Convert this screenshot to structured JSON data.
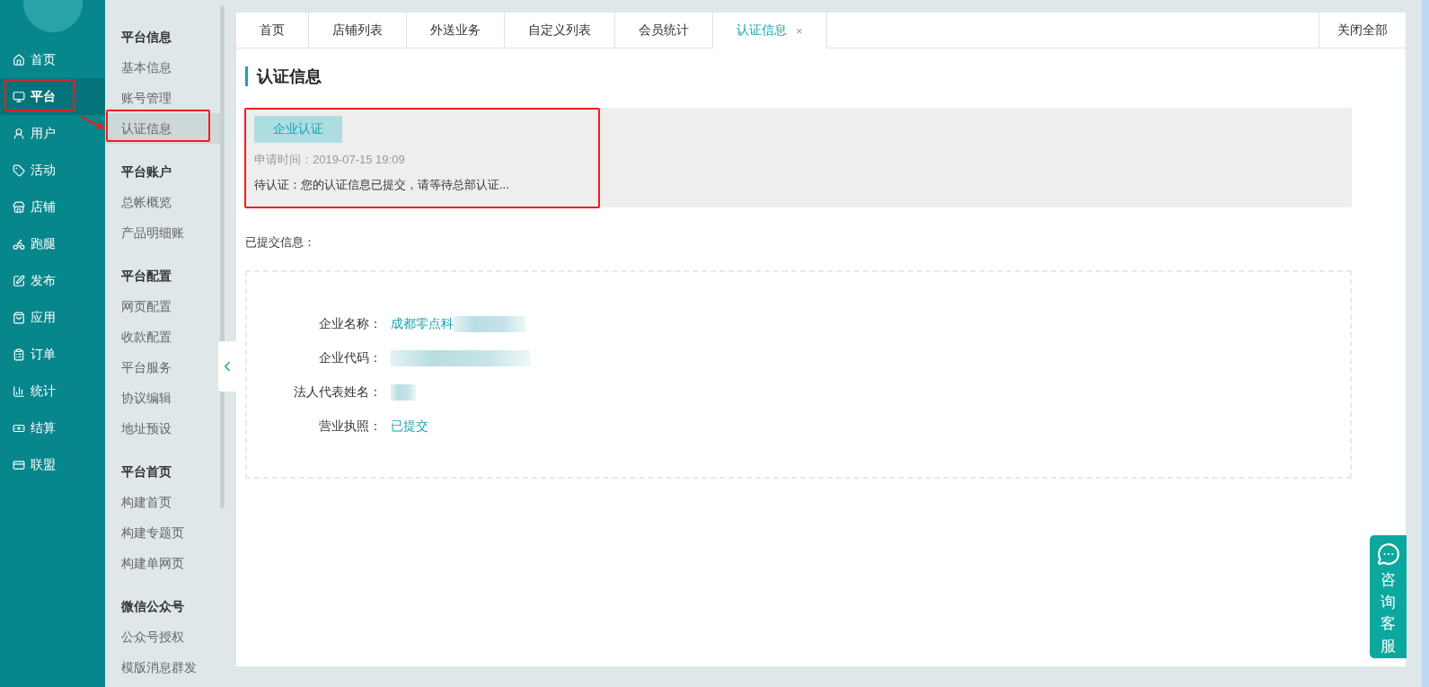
{
  "nav_rail": {
    "items": [
      {
        "label": "首页",
        "selected": false
      },
      {
        "label": "平台",
        "selected": true
      },
      {
        "label": "用户",
        "selected": false
      },
      {
        "label": "活动",
        "selected": false
      },
      {
        "label": "店铺",
        "selected": false
      },
      {
        "label": "跑腿",
        "selected": false
      },
      {
        "label": "发布",
        "selected": false
      },
      {
        "label": "应用",
        "selected": false
      },
      {
        "label": "订单",
        "selected": false
      },
      {
        "label": "统计",
        "selected": false
      },
      {
        "label": "结算",
        "selected": false
      },
      {
        "label": "联盟",
        "selected": false
      }
    ]
  },
  "sub_nav": {
    "groups": [
      {
        "title": "平台信息",
        "items": [
          {
            "label": "基本信息",
            "selected": false
          },
          {
            "label": "账号管理",
            "selected": false
          },
          {
            "label": "认证信息",
            "selected": true
          }
        ]
      },
      {
        "title": "平台账户",
        "items": [
          {
            "label": "总帐概览",
            "selected": false
          },
          {
            "label": "产品明细账",
            "selected": false
          }
        ]
      },
      {
        "title": "平台配置",
        "items": [
          {
            "label": "网页配置",
            "selected": false
          },
          {
            "label": "收款配置",
            "selected": false
          },
          {
            "label": "平台服务",
            "selected": false
          },
          {
            "label": "协议编辑",
            "selected": false
          },
          {
            "label": "地址预设",
            "selected": false
          }
        ]
      },
      {
        "title": "平台首页",
        "items": [
          {
            "label": "构建首页",
            "selected": false
          },
          {
            "label": "构建专题页",
            "selected": false
          },
          {
            "label": "构建单网页",
            "selected": false
          }
        ]
      },
      {
        "title": "微信公众号",
        "items": [
          {
            "label": "公众号授权",
            "selected": false
          },
          {
            "label": "模版消息群发",
            "selected": false
          }
        ]
      }
    ]
  },
  "tabs": [
    {
      "label": "首页",
      "selected": false,
      "closable": false
    },
    {
      "label": "店铺列表",
      "selected": false,
      "closable": false
    },
    {
      "label": "外送业务",
      "selected": false,
      "closable": false
    },
    {
      "label": "自定义列表",
      "selected": false,
      "closable": false
    },
    {
      "label": "会员统计",
      "selected": false,
      "closable": false
    },
    {
      "label": "认证信息",
      "selected": true,
      "closable": true
    }
  ],
  "close_icon": "×",
  "close_all": "关闭全部",
  "page_title": "认证信息",
  "cert_card": {
    "button": "企业认证",
    "apply_time": "申请时间：2019-07-15 19:09",
    "status": "待认证：您的认证信息已提交，请等待总部认证..."
  },
  "submitted_label": "已提交信息：",
  "fields": [
    {
      "label": "企业名称：",
      "value": "成都零点科",
      "masked": true
    },
    {
      "label": "企业代码：",
      "masked": true
    },
    {
      "label": "法人代表姓名：",
      "masked": true
    },
    {
      "label": "营业执照：",
      "value": "已提交",
      "masked": false
    }
  ],
  "chat_widget": {
    "label": "咨询客服"
  }
}
